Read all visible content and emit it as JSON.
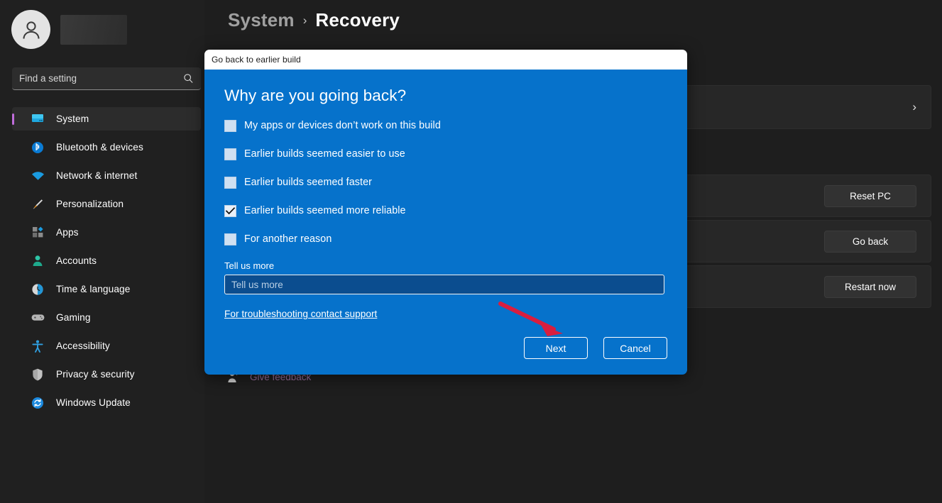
{
  "sidebar": {
    "profile": {
      "avatar_icon": "user-avatar-icon",
      "name_redacted": true
    },
    "search": {
      "placeholder": "Find a setting",
      "value": "",
      "icon": "search-icon"
    },
    "items": [
      {
        "label": "System",
        "icon": "monitor-icon",
        "active": true
      },
      {
        "label": "Bluetooth & devices",
        "icon": "bluetooth-icon",
        "active": false
      },
      {
        "label": "Network & internet",
        "icon": "wifi-icon",
        "active": false
      },
      {
        "label": "Personalization",
        "icon": "paintbrush-icon",
        "active": false
      },
      {
        "label": "Apps",
        "icon": "apps-grid-icon",
        "active": false
      },
      {
        "label": "Accounts",
        "icon": "person-icon",
        "active": false
      },
      {
        "label": "Time & language",
        "icon": "clock-icon",
        "active": false
      },
      {
        "label": "Gaming",
        "icon": "gamepad-icon",
        "active": false
      },
      {
        "label": "Accessibility",
        "icon": "accessibility-icon",
        "active": false
      },
      {
        "label": "Privacy & security",
        "icon": "shield-icon",
        "active": false
      },
      {
        "label": "Windows Update",
        "icon": "update-refresh-icon",
        "active": false
      }
    ]
  },
  "main": {
    "breadcrumb": {
      "parent": "System",
      "separator": "›",
      "current": "Recovery"
    },
    "rows": [
      {
        "type": "chevron",
        "chevron": "›"
      },
      {
        "type": "spacer"
      },
      {
        "type": "button",
        "button_label": "Reset PC"
      },
      {
        "type": "button",
        "button_label": "Go back"
      },
      {
        "type": "button",
        "button_label": "Restart now"
      }
    ],
    "feedback": {
      "label": "Give feedback",
      "icon": "feedback-person-icon"
    }
  },
  "dialog": {
    "titlebar": "Go back to earlier build",
    "heading": "Why are you going back?",
    "options": [
      {
        "label": "My apps or devices don’t work on this build",
        "checked": false
      },
      {
        "label": "Earlier builds seemed easier to use",
        "checked": false
      },
      {
        "label": "Earlier builds seemed faster",
        "checked": false
      },
      {
        "label": "Earlier builds seemed more reliable",
        "checked": true
      },
      {
        "label": "For another reason",
        "checked": false
      }
    ],
    "tell_us_more": {
      "label": "Tell us more",
      "placeholder": "Tell us more",
      "value": ""
    },
    "support_link": "For troubleshooting contact support",
    "buttons": {
      "primary": "Next",
      "secondary": "Cancel"
    }
  },
  "annotation": {
    "arrow_color": "#d81e3f",
    "arrow_points_to": "Next"
  },
  "colors": {
    "dialog_blue": "#0672cb",
    "app_background": "#1e1e1e",
    "sidebar_background": "#202020",
    "accent_bar": "#c06ddb",
    "feedback_text": "#9a6f9e"
  }
}
